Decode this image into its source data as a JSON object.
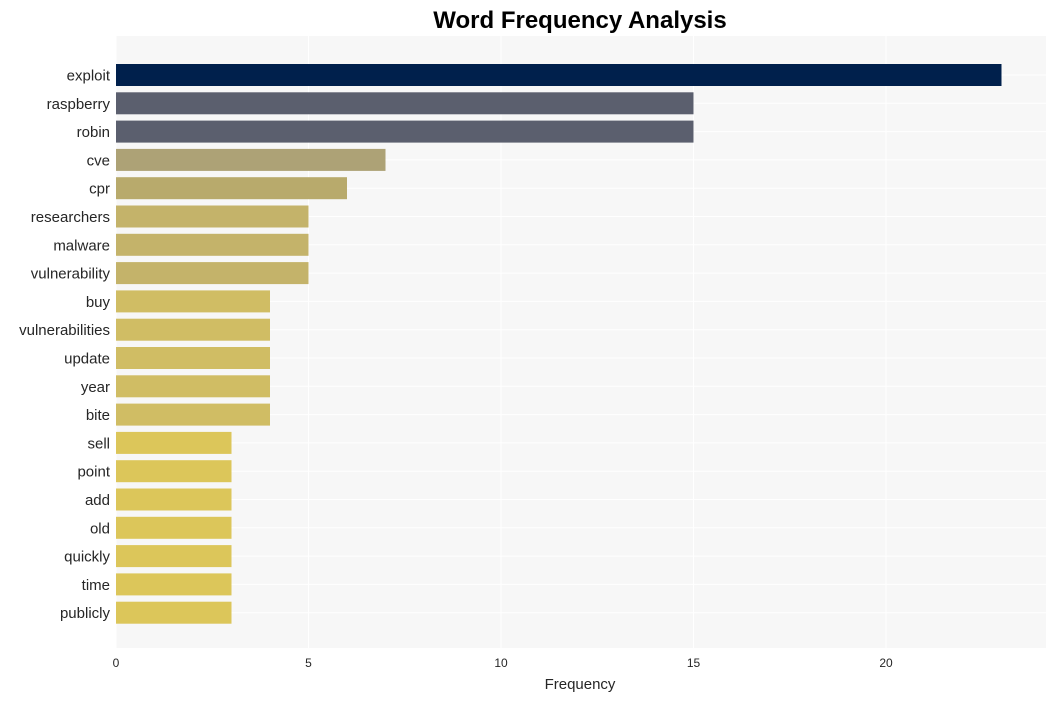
{
  "chart_data": {
    "type": "bar",
    "orientation": "horizontal",
    "title": "Word Frequency Analysis",
    "xlabel": "Frequency",
    "ylabel": "",
    "xlim": [
      0,
      24.2
    ],
    "xticks": [
      0,
      5,
      10,
      15,
      20
    ],
    "grid": true,
    "legend": "none",
    "categories": [
      "exploit",
      "raspberry",
      "robin",
      "cve",
      "cpr",
      "researchers",
      "malware",
      "vulnerability",
      "buy",
      "vulnerabilities",
      "update",
      "year",
      "bite",
      "sell",
      "point",
      "add",
      "old",
      "quickly",
      "time",
      "publicly"
    ],
    "values": [
      23,
      15,
      15,
      7,
      6,
      5,
      5,
      5,
      4,
      4,
      4,
      4,
      4,
      3,
      3,
      3,
      3,
      3,
      3,
      3
    ],
    "colors": [
      "#00204c",
      "#5b5f6e",
      "#5b5f6e",
      "#ada276",
      "#b8aa6c",
      "#c4b36a",
      "#c4b36a",
      "#c4b36a",
      "#d0bd64",
      "#d0bd64",
      "#d0bd64",
      "#d0bd64",
      "#d0bd64",
      "#dcc65a",
      "#dcc65a",
      "#dcc65a",
      "#dcc65a",
      "#dcc65a",
      "#dcc65a",
      "#dcc65a"
    ]
  }
}
